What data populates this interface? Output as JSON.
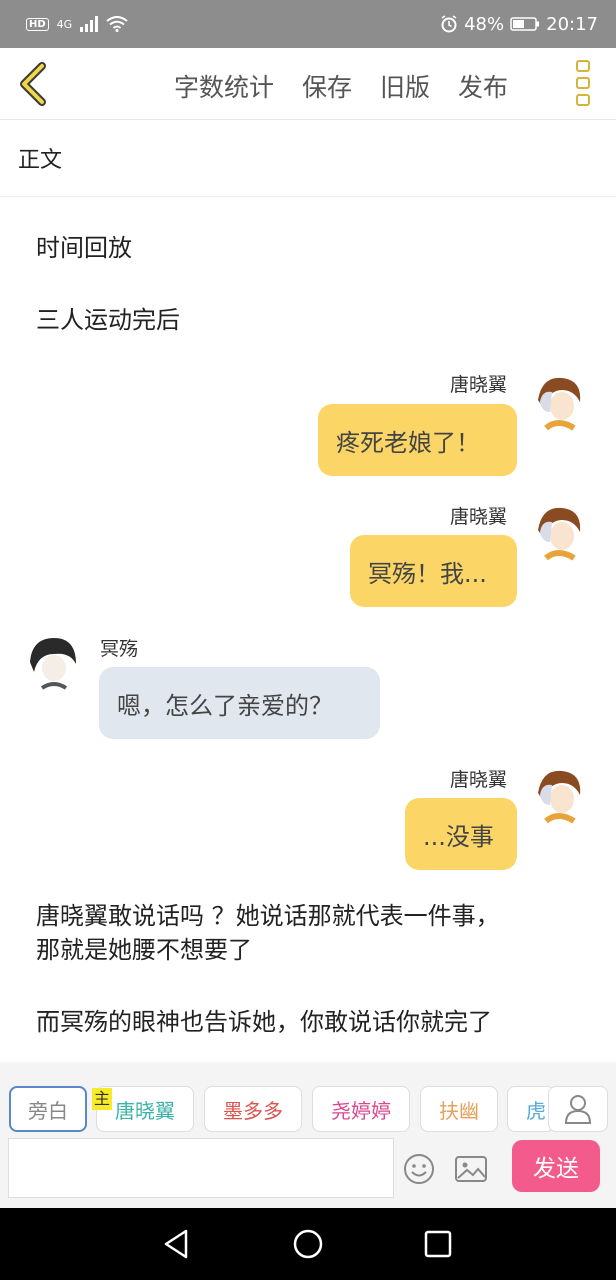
{
  "status_bar": {
    "network": "4G",
    "battery": "48%",
    "time": "20:17",
    "icons": [
      "hd-icon",
      "signal-icon",
      "wifi-icon",
      "alarm-icon",
      "battery-icon"
    ]
  },
  "toolbar": {
    "word_count_label": "字数统计",
    "save_label": "保存",
    "old_version_label": "旧版",
    "publish_label": "发布"
  },
  "section_title": "正文",
  "narration": {
    "line1": "时间回放",
    "line2": "三人运动完后",
    "para1_line1": "唐晓翼敢说话吗 ？她说话那就代表一件事，",
    "para1_line2": "那就是她腰不想要了",
    "para2": "而冥殇的眼神也告诉她，你敢说话你就完了"
  },
  "messages": [
    {
      "speaker": "唐晓翼",
      "text": "疼死老娘了！",
      "side": "right"
    },
    {
      "speaker": "唐晓翼",
      "text": "冥殇！我...",
      "side": "right"
    },
    {
      "speaker": "冥殇",
      "text": "嗯，怎么了亲爱的？",
      "side": "left"
    },
    {
      "speaker": "唐晓翼",
      "text": "...没事",
      "side": "right"
    }
  ],
  "character_bar": {
    "narrator": "旁白",
    "host_badge": "主",
    "chars": [
      "唐晓翼",
      "墨多多",
      "尧婷婷",
      "扶幽",
      "虎"
    ],
    "char_colors": [
      "#3bb3a8",
      "#d9534f",
      "#d9478f",
      "#e6a05a",
      "#5aa9d6"
    ]
  },
  "composer": {
    "send_label": "发送"
  },
  "colors": {
    "accent_yellow": "#fbd667",
    "send_pink": "#f35b8d",
    "left_bubble": "#e1e7ef"
  }
}
